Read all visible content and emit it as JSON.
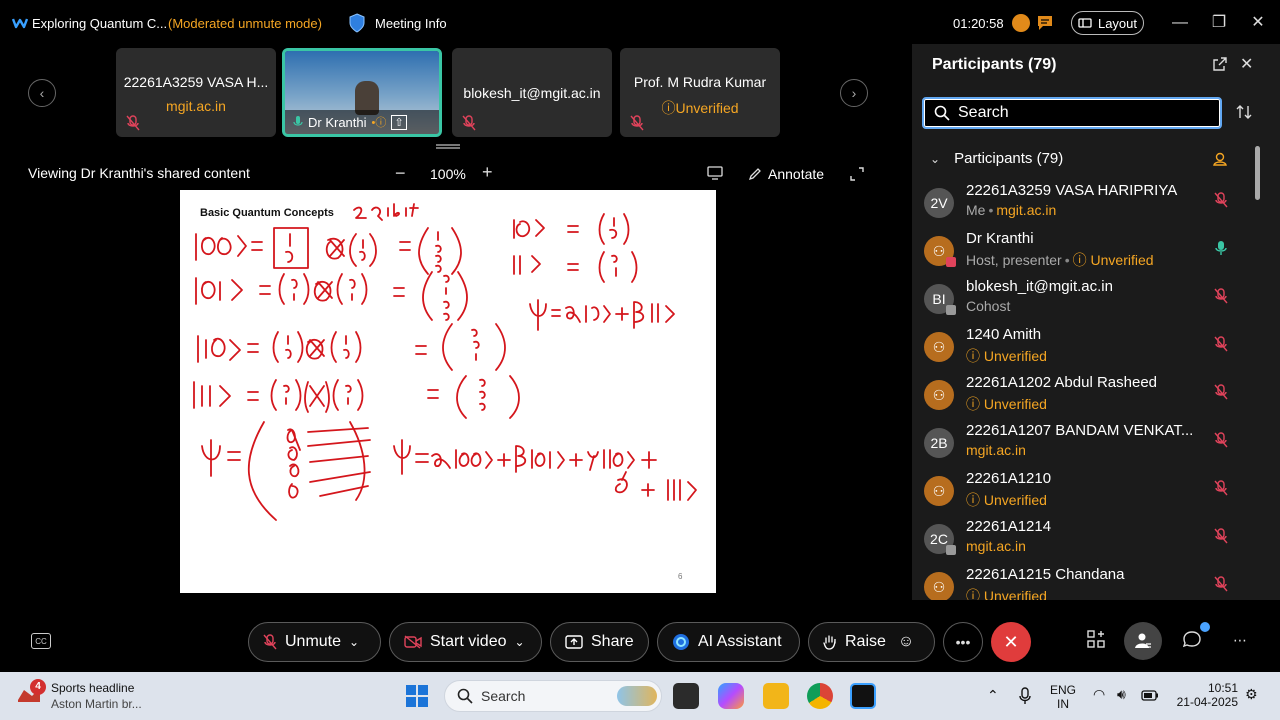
{
  "titlebar": {
    "meeting_title": "Exploring Quantum C...",
    "mode": "(Moderated unmute mode)",
    "meeting_info": "Meeting Info",
    "timer": "01:20:58",
    "layout_label": "Layout"
  },
  "thumbnails": [
    {
      "name": "22261A3259 VASA H...",
      "sub": "mgit.ac.in"
    },
    {
      "name": "Dr Kranthi"
    },
    {
      "name": "blokesh_it@mgit.ac.in",
      "sub": ""
    },
    {
      "name": "Prof. M Rudra Kumar",
      "sub": "Unverified"
    }
  ],
  "share": {
    "viewing_label": "Viewing Dr Kranthi's shared content",
    "zoom": "100%",
    "annotate_label": "Annotate",
    "slide_title": "Basic Quantum Concepts",
    "slide_number": "6"
  },
  "participants": {
    "title": "Participants (79)",
    "search_placeholder": "Search",
    "group_label": "Participants (79)",
    "list": [
      {
        "initials": "2V",
        "name": "22261A3259 VASA HARIPRIYA",
        "role": "Me",
        "detail": "mgit.ac.in",
        "detail_warn": false,
        "avatar": "grey",
        "mic": "muted"
      },
      {
        "initials": "",
        "name": "Dr Kranthi",
        "role": "Host, presenter",
        "detail": "Unverified",
        "detail_warn": true,
        "avatar": "orange",
        "mic": "on"
      },
      {
        "initials": "BI",
        "name": "blokesh_it@mgit.ac.in",
        "role": "Cohost",
        "detail": "",
        "detail_warn": false,
        "avatar": "grey",
        "mic": "muted"
      },
      {
        "initials": "",
        "name": "1240 Amith",
        "role": "",
        "detail": "Unverified",
        "detail_warn": true,
        "avatar": "orange",
        "mic": "muted"
      },
      {
        "initials": "",
        "name": "22261A1202 Abdul Rasheed",
        "role": "",
        "detail": "Unverified",
        "detail_warn": true,
        "avatar": "orange",
        "mic": "muted"
      },
      {
        "initials": "2B",
        "name": "22261A1207 BANDAM VENKAT...",
        "role": "",
        "detail": "mgit.ac.in",
        "detail_warn": false,
        "avatar": "grey",
        "mic": "muted"
      },
      {
        "initials": "",
        "name": "22261A1210",
        "role": "",
        "detail": "Unverified",
        "detail_warn": true,
        "avatar": "orange",
        "mic": "muted"
      },
      {
        "initials": "2C",
        "name": "22261A1214",
        "role": "",
        "detail": "mgit.ac.in",
        "detail_warn": false,
        "avatar": "grey",
        "mic": "muted"
      },
      {
        "initials": "",
        "name": "22261A1215 Chandana",
        "role": "",
        "detail": "Unverified",
        "detail_warn": true,
        "avatar": "orange",
        "mic": "muted"
      }
    ]
  },
  "controls": {
    "unmute": "Unmute",
    "start_video": "Start video",
    "share": "Share",
    "ai_assistant": "AI Assistant",
    "raise": "Raise"
  },
  "taskbar": {
    "news_badge": "4",
    "news_title": "Sports headline",
    "news_sub": "Aston Martin br...",
    "search_placeholder": "Search",
    "lang1": "ENG",
    "lang2": "IN",
    "time": "10:51",
    "date": "21-04-2025"
  },
  "colors": {
    "warning": "#f5a623",
    "accent_teal": "#3ac6a5",
    "leave_red": "#e03c3c",
    "search_focus": "#62a8f3"
  }
}
